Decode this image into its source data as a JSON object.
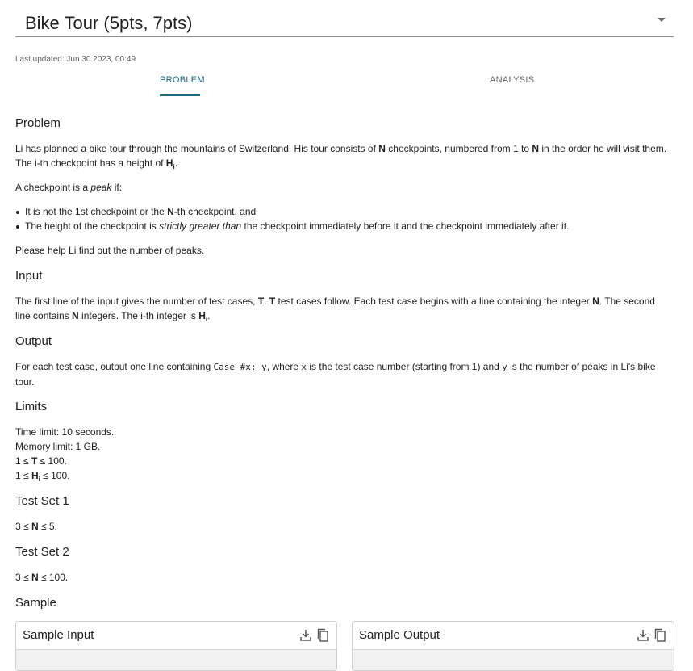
{
  "header": {
    "title": "Bike Tour (5pts, 7pts)",
    "dropdown_icon": "arrow-drop-down-icon"
  },
  "meta": {
    "last_updated": "Last updated: Jun 30 2023, 00:49"
  },
  "tabs": [
    {
      "label": "PROBLEM",
      "active": true
    },
    {
      "label": "ANALYSIS",
      "active": false
    }
  ],
  "colors": {
    "accent": "#1a6a84",
    "text": "#202124",
    "muted": "#5f6368"
  },
  "problem": {
    "heading": "Problem",
    "p1_a": "Li has planned a bike tour through the mountains of Switzerland. His tour consists of ",
    "p1_N1": "N",
    "p1_b": " checkpoints, numbered from 1 to ",
    "p1_N2": "N",
    "p1_c": " in the order he will visit them. The i-th checkpoint has a height of ",
    "p1_H": "H",
    "p1_Hsub": "i",
    "p1_end": ".",
    "p2_a": "A checkpoint is a ",
    "p2_em": "peak",
    "p2_b": " if:",
    "bullet1_a": "It is not the 1st checkpoint or the ",
    "bullet1_N": "N",
    "bullet1_b": "-th checkpoint, and",
    "bullet2_a": "The height of the checkpoint is ",
    "bullet2_em": "strictly greater than",
    "bullet2_b": " the checkpoint immediately before it and the checkpoint immediately after it.",
    "p3": "Please help Li find out the number of peaks."
  },
  "input": {
    "heading": "Input",
    "a": "The first line of the input gives the number of test cases, ",
    "T1": "T",
    "b": ". ",
    "T2": "T",
    "c": " test cases follow. Each test case begins with a line containing the integer ",
    "N1": "N",
    "d": ". The second line contains ",
    "N2": "N",
    "e": " integers. The i-th integer is ",
    "H": "H",
    "Hsub": "i",
    "f": "."
  },
  "output": {
    "heading": "Output",
    "a": "For each test case, output one line containing ",
    "code": "Case #x: y",
    "b": ", where ",
    "x": "x",
    "c": " is the test case number (starting from 1) and ",
    "y": "y",
    "d": " is the number of peaks in Li's bike tour."
  },
  "limits": {
    "heading": "Limits",
    "time": "Time limit: 10 seconds.",
    "memory": "Memory limit: 1 GB.",
    "t_lo": "1 ≤ ",
    "t_var": "T",
    "t_hi": " ≤ 100.",
    "h_lo": "1 ≤ ",
    "h_var": "H",
    "h_sub": "i",
    "h_hi": " ≤ 100."
  },
  "test_set_1": {
    "heading": "Test Set 1",
    "lo": "3 ≤ ",
    "var": "N",
    "hi": " ≤ 5."
  },
  "test_set_2": {
    "heading": "Test Set 2",
    "lo": "3 ≤ ",
    "var": "N",
    "hi": " ≤ 100."
  },
  "sample": {
    "heading": "Sample",
    "input_title": "Sample Input",
    "output_title": "Sample Output",
    "download_icon": "download-icon",
    "copy_icon": "copy-icon"
  }
}
